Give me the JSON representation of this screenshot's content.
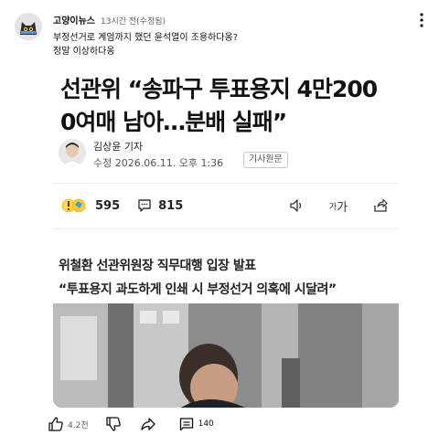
{
  "post": {
    "author": "고양이뉴스",
    "time": "13시간 전(수정됨)",
    "body_line1": "부정선거로 계엄까지 했던 윤석열이 조용하다옹?",
    "body_line2": "정말 이상하다옹"
  },
  "article": {
    "headline_line1": "선관위 “송파구 투표용지 4만200",
    "headline_line2": "0여매 남아…분배 실패”",
    "reporter": "김상윤 기자",
    "modified": "수정 2026.06.11. 오후 1:36",
    "original_button": "기사원문",
    "reaction_count": "595",
    "comment_count": "815",
    "font_tool": "가",
    "font_tool_small": "가",
    "subhead1": "위철환 선관위원장 직무대행 입장 발표",
    "subhead2": "“투표용지 과도하게 인쇄 시 부정선거 의혹에 시달려”"
  },
  "actions": {
    "likes": "4.2천",
    "comments": "140"
  },
  "icons": {
    "more": "more-vert-icon",
    "like": "thumbs-up-icon",
    "dislike": "thumbs-down-icon",
    "share": "share-icon",
    "comment": "comment-icon",
    "audio": "speaker-icon",
    "article_share": "share-arrow-icon"
  }
}
